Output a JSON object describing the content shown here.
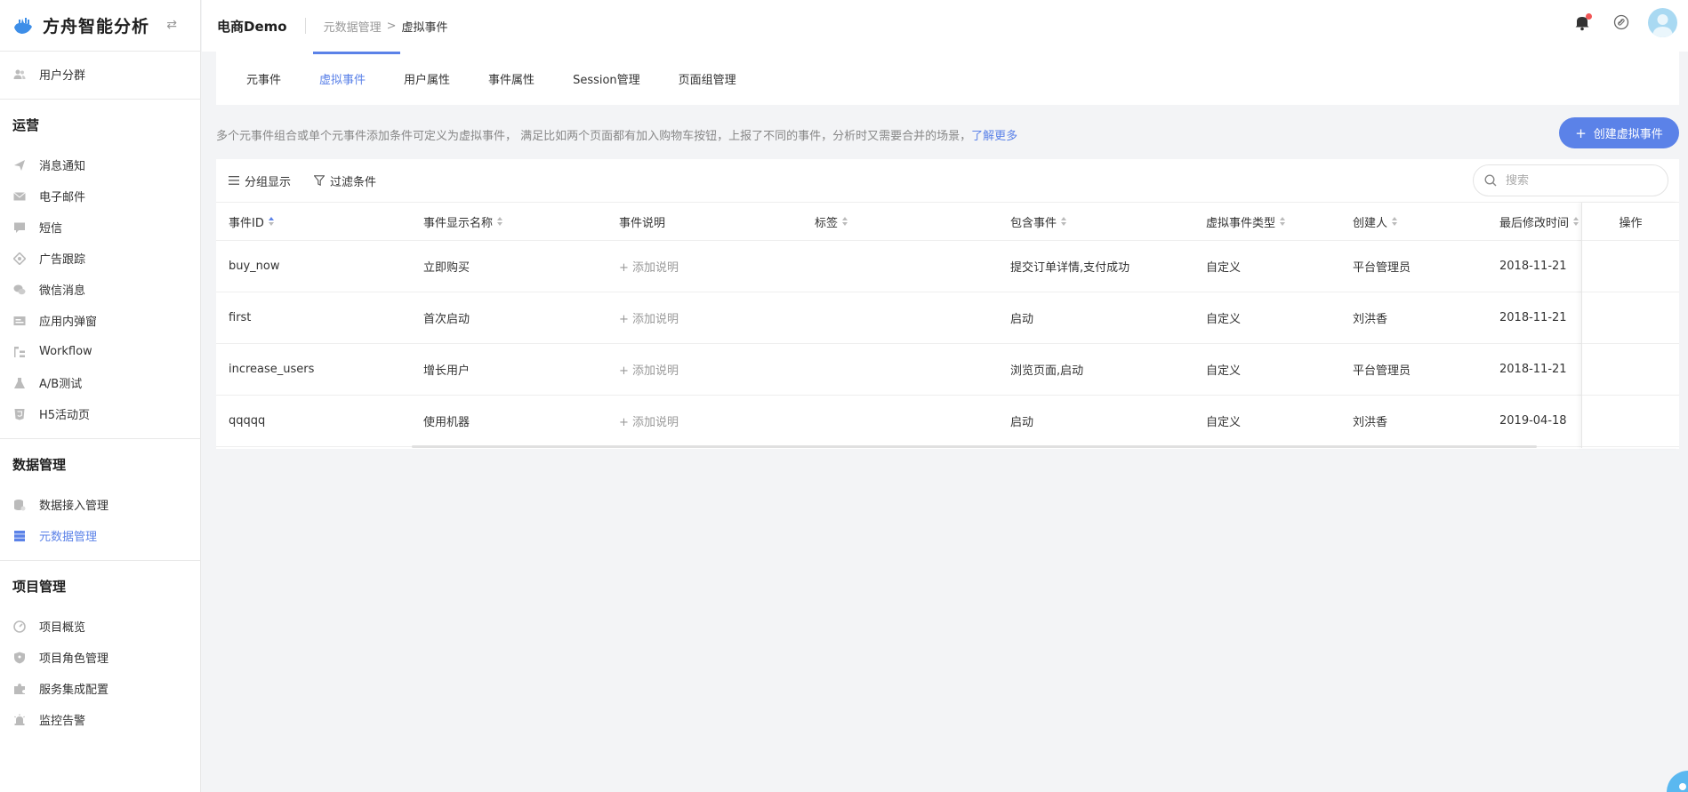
{
  "brand": {
    "name": "方舟智能分析",
    "collapse_icon": "swap-icon"
  },
  "sidebar": {
    "top_items": [
      {
        "label": "用户分群",
        "icon": "users-icon"
      }
    ],
    "groups": [
      {
        "title": "运营",
        "items": [
          {
            "label": "消息通知",
            "icon": "send-icon"
          },
          {
            "label": "电子邮件",
            "icon": "mail-icon"
          },
          {
            "label": "短信",
            "icon": "sms-icon"
          },
          {
            "label": "广告跟踪",
            "icon": "target-icon"
          },
          {
            "label": "微信消息",
            "icon": "wechat-icon"
          },
          {
            "label": "应用内弹窗",
            "icon": "popup-icon"
          },
          {
            "label": "Workflow",
            "icon": "workflow-icon"
          },
          {
            "label": "A/B测试",
            "icon": "flask-icon"
          },
          {
            "label": "H5活动页",
            "icon": "html5-icon"
          }
        ]
      },
      {
        "title": "数据管理",
        "items": [
          {
            "label": "数据接入管理",
            "icon": "database-icon"
          },
          {
            "label": "元数据管理",
            "icon": "server-icon",
            "active": true
          }
        ]
      },
      {
        "title": "项目管理",
        "items": [
          {
            "label": "项目概览",
            "icon": "gauge-icon"
          },
          {
            "label": "项目角色管理",
            "icon": "shield-icon"
          },
          {
            "label": "服务集成配置",
            "icon": "puzzle-icon"
          },
          {
            "label": "监控告警",
            "icon": "alarm-icon"
          }
        ]
      }
    ]
  },
  "header": {
    "project": "电商Demo",
    "breadcrumb_parent": "元数据管理",
    "breadcrumb_sep": ">",
    "breadcrumb_current": "虚拟事件"
  },
  "tabs": [
    {
      "label": "元事件"
    },
    {
      "label": "虚拟事件",
      "active": true
    },
    {
      "label": "用户属性"
    },
    {
      "label": "事件属性"
    },
    {
      "label": "Session管理"
    },
    {
      "label": "页面组管理"
    }
  ],
  "description": {
    "text": "多个元事件组合或单个元事件添加条件可定义为虚拟事件， 满足比如两个页面都有加入购物车按钮，上报了不同的事件，分析时又需要合并的场景，",
    "link": "了解更多"
  },
  "create_button": {
    "label": "创建虚拟事件"
  },
  "toolbar": {
    "group_label": "分组显示",
    "filter_label": "过滤条件",
    "search_placeholder": "搜索"
  },
  "table": {
    "columns": [
      "事件ID",
      "事件显示名称",
      "事件说明",
      "标签",
      "包含事件",
      "虚拟事件类型",
      "创建人",
      "最后修改时间",
      "操作"
    ],
    "add_desc": "+ 添加说明",
    "rows": [
      {
        "id": "buy_now",
        "name": "立即购买",
        "tag": "",
        "events": "提交订单详情,支付成功",
        "type": "自定义",
        "creator": "平台管理员",
        "modified": "2018-11-21"
      },
      {
        "id": "first",
        "name": "首次启动",
        "tag": "",
        "events": "启动",
        "type": "自定义",
        "creator": "刘洪香",
        "modified": "2018-11-21"
      },
      {
        "id": "increase_users",
        "name": "增长用户",
        "tag": "",
        "events": "浏览页面,启动",
        "type": "自定义",
        "creator": "平台管理员",
        "modified": "2018-11-21"
      },
      {
        "id": "qqqqq",
        "name": "使用机器",
        "tag": "",
        "events": "启动",
        "type": "自定义",
        "creator": "刘洪香",
        "modified": "2019-04-18"
      }
    ]
  },
  "colors": {
    "accent": "#5b82e8",
    "notify_dot": "#f25656"
  }
}
